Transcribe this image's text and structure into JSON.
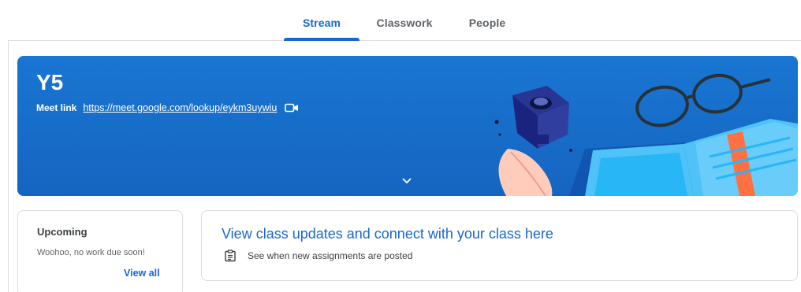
{
  "nav": {
    "tabs": [
      {
        "label": "Stream",
        "active": true
      },
      {
        "label": "Classwork",
        "active": false
      },
      {
        "label": "People",
        "active": false
      }
    ]
  },
  "banner": {
    "class_name": "Y5",
    "meet_label": "Meet link",
    "meet_url": "https://meet.google.com/lookup/eykm3uywiu",
    "video_icon": "video-camera-icon",
    "expand_icon": "chevron-down-icon"
  },
  "upcoming": {
    "title": "Upcoming",
    "empty_text": "Woohoo, no work due soon!",
    "view_all": "View all"
  },
  "updates": {
    "title": "View class updates and connect with your class here",
    "hint": "See when new assignments are posted",
    "hint_icon": "assignment-icon"
  },
  "colors": {
    "accent": "#1967d2",
    "banner": "#1976d2",
    "text": "#3c4043",
    "muted": "#5f6368",
    "border": "#dadce0"
  }
}
